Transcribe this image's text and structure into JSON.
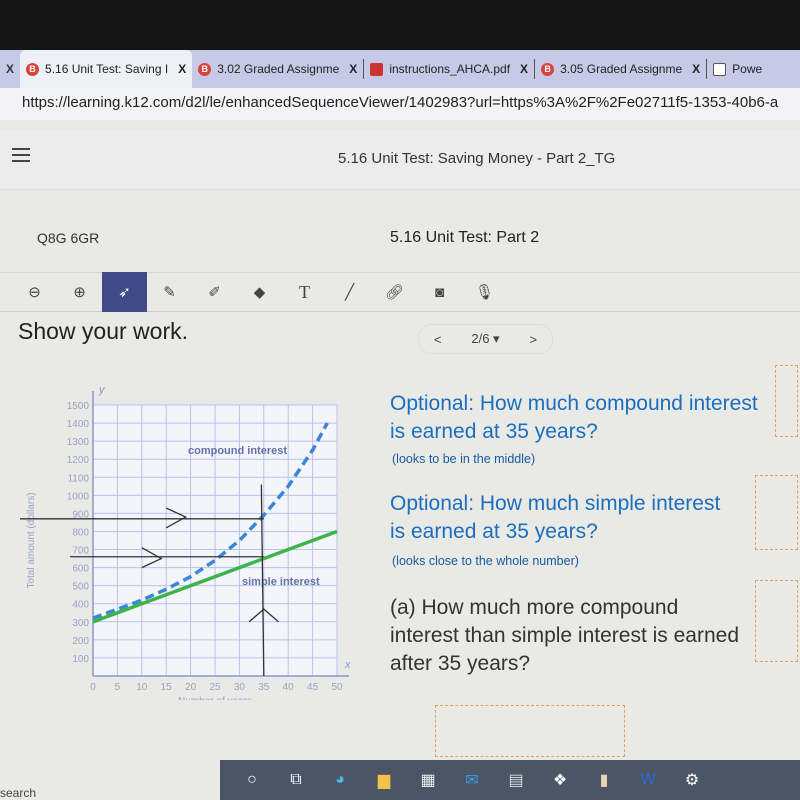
{
  "browser": {
    "tabs": [
      {
        "label": "5.16 Unit Test: Saving I",
        "icon": "brightspace-icon",
        "active": true
      },
      {
        "label": "3.02 Graded Assignme",
        "icon": "brightspace-icon"
      },
      {
        "label": "instructions_AHCA.pdf",
        "icon": "pdf-icon"
      },
      {
        "label": "3.05 Graded Assignme",
        "icon": "brightspace-icon"
      },
      {
        "label": "Powe",
        "icon": "document-icon"
      }
    ],
    "close_glyph": "X",
    "url": "https://learning.k12.com/d2l/le/enhancedSequenceViewer/1402983?url=https%3A%2F%2Fe02711f5-1353-40b6-a"
  },
  "header": {
    "title": "5.16 Unit Test: Saving Money - Part 2_TG"
  },
  "subheader": {
    "left": "Q8G 6GR",
    "right": "5.16 Unit Test: Part 2"
  },
  "toolbar": {
    "tools": [
      "zoom-out",
      "zoom-in",
      "select",
      "pen",
      "highlighter",
      "eraser",
      "text",
      "line",
      "link",
      "camera",
      "microphone"
    ],
    "text_glyph": "T",
    "selected": "select"
  },
  "main": {
    "instruction": "Show your work.",
    "pager": {
      "prev": "<",
      "current": "2/6 ▾",
      "next": ">"
    },
    "questions": [
      {
        "text": "Optional: How much compound interest is earned at 35 years?",
        "hint": "(looks to be in the middle)"
      },
      {
        "text": "Optional: How much simple interest is earned at 35 years?",
        "hint": "(looks close to the whole number)"
      },
      {
        "text": "(a) How much more compound interest than simple interest is earned after 35 years?"
      }
    ]
  },
  "chart_data": {
    "type": "line",
    "xlabel": "Number of years",
    "ylabel": "Total amount (dollars)",
    "x_axis_letter": "x",
    "y_axis_letter": "y",
    "xlim": [
      0,
      50
    ],
    "ylim": [
      0,
      1500
    ],
    "xticks": [
      "0",
      "5",
      "10",
      "15",
      "20",
      "25",
      "30",
      "35",
      "40",
      "45",
      "50"
    ],
    "yticks": [
      "100",
      "200",
      "300",
      "400",
      "500",
      "600",
      "700",
      "800",
      "900",
      "1000",
      "1100",
      "1200",
      "1300",
      "1400",
      "1500"
    ],
    "grid": true,
    "series": [
      {
        "name": "compound interest",
        "style": "dashed",
        "color": "#3a86d8",
        "x": [
          0,
          5,
          10,
          15,
          20,
          25,
          30,
          35,
          40,
          45,
          48
        ],
        "y": [
          320,
          370,
          420,
          480,
          550,
          640,
          750,
          890,
          1050,
          1250,
          1400
        ]
      },
      {
        "name": "simple interest",
        "style": "solid",
        "color": "#3bb54a",
        "x": [
          0,
          50
        ],
        "y": [
          300,
          800
        ]
      }
    ]
  },
  "taskbar": {
    "search": "search",
    "icons": [
      "cortana-icon",
      "task-view-icon",
      "edge-icon",
      "file-explorer-icon",
      "store-icon",
      "mail-icon",
      "amazon-icon",
      "dropbox-icon",
      "onedrive-folder-icon",
      "word-icon",
      "settings-icon"
    ]
  }
}
